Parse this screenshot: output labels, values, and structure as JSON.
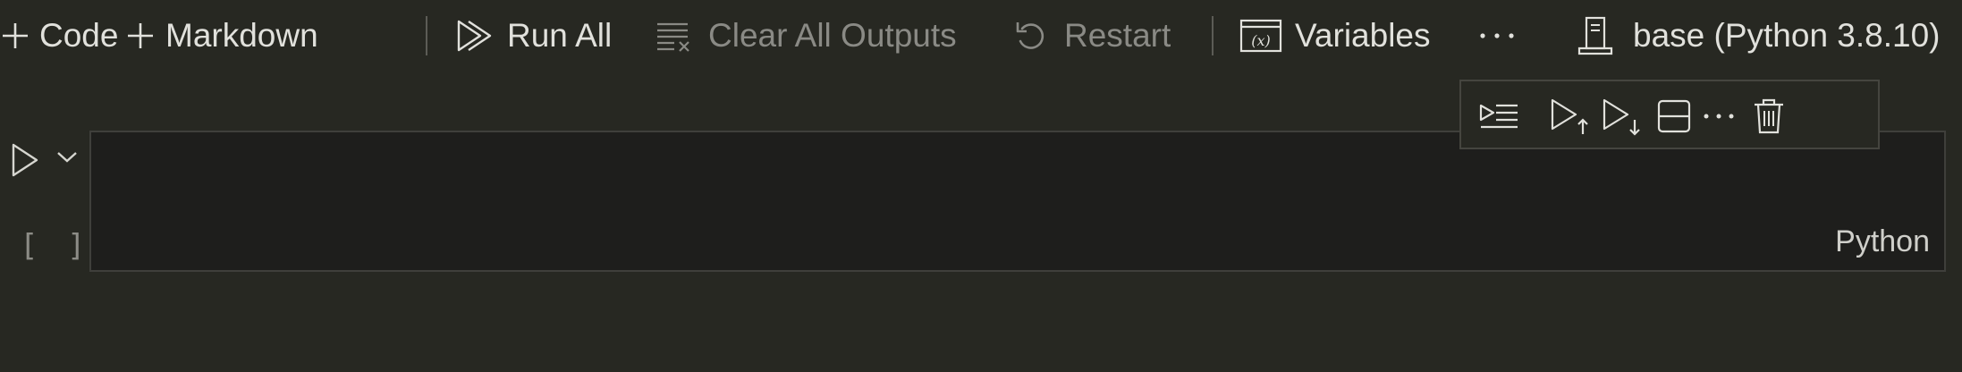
{
  "toolbar": {
    "add_code_label": "Code",
    "add_markdown_label": "Markdown",
    "run_all_label": "Run All",
    "clear_outputs_label": "Clear All Outputs",
    "restart_label": "Restart",
    "variables_label": "Variables",
    "more_icon": "ellipsis-icon",
    "kernel_label": "base (Python 3.8.10)"
  },
  "cell": {
    "execution_count": "[ ]",
    "language": "Python",
    "toolbar_icons": [
      "execute-above-cells-icon",
      "run-above-icon",
      "run-below-icon",
      "split-cell-icon",
      "more-actions-icon",
      "delete-cell-icon"
    ]
  },
  "colors": {
    "background": "#272822",
    "editor_background": "#1e1e1c",
    "text": "#e1e1dc",
    "disabled_text": "#8a8a85"
  }
}
